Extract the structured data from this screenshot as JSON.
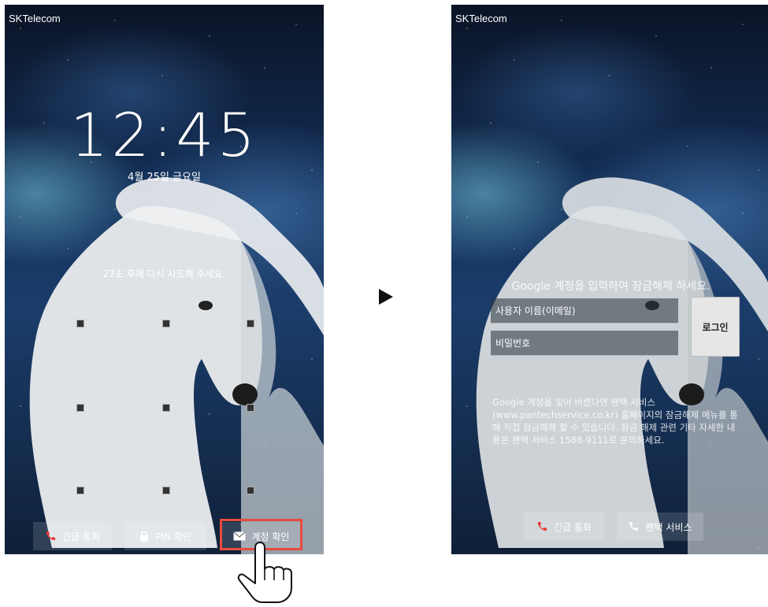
{
  "left_screen": {
    "carrier": "SKTelecom",
    "time": "12:45",
    "date": "4월 25일 금요일",
    "retry_message": "27초 후에 다시 시도해 주세요.",
    "buttons": {
      "emergency_call": "긴급 통화",
      "pin_check": "PIN 확인",
      "account_check": "계정 확인"
    }
  },
  "right_screen": {
    "carrier": "SKTelecom",
    "google_title": "Google 계정을 입력하여 잠금해제 하세요.",
    "username_placeholder": "사용자 이름(이메일)",
    "password_placeholder": "비밀번호",
    "login_button": "로그인",
    "help_text": "Google 계정을 잊어 버렸다면 팬택 서비스(www.pantechservice.co.kr) 홈페이지의 잠금해제 메뉴를 통해 직접 잠금해제 할 수 있습니다. 잠금 해제 관련 기타 자세한 내용은 팬택 서비스 1588-9111로 문의하세요.",
    "buttons": {
      "emergency_call": "긴급 통화",
      "pantech_service": "팬택 서비스"
    }
  },
  "colors": {
    "highlight": "#e84c3d",
    "phone_icon_red": "#e53935"
  }
}
